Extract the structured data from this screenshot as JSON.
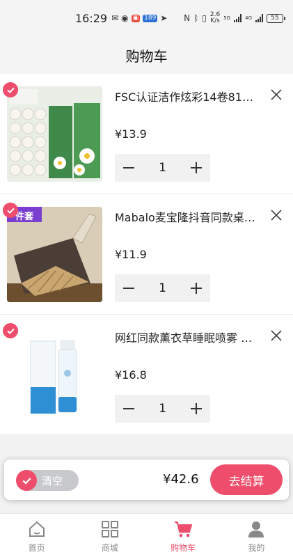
{
  "status_bar": {
    "time": "16:29",
    "badge_189": "189",
    "net_speed_value": "2.6",
    "net_speed_unit": "K/s",
    "sig1_label": "5G",
    "sig2_label": "4G",
    "battery": "55"
  },
  "header": {
    "title": "购物车"
  },
  "cart": {
    "items": [
      {
        "name": "FSC认证洁作炫彩14卷81…",
        "price": "¥13.9",
        "qty": "1",
        "checked": true,
        "thumb_tag": ""
      },
      {
        "name": "Mabalo麦宝隆抖音同款桌…",
        "price": "¥11.9",
        "qty": "1",
        "checked": true,
        "thumb_tag": "件套"
      },
      {
        "name": "网红同款薰衣草睡眠喷雾 …",
        "price": "¥16.8",
        "qty": "1",
        "checked": true,
        "thumb_tag": ""
      }
    ]
  },
  "checkout": {
    "clear_label": "清空",
    "total": "¥42.6",
    "button_label": "去结算"
  },
  "tabbar": {
    "tabs": [
      {
        "label": "首页",
        "icon": "home-icon",
        "active": false
      },
      {
        "label": "商城",
        "icon": "grid-icon",
        "active": false
      },
      {
        "label": "购物车",
        "icon": "cart-icon",
        "active": true
      },
      {
        "label": "我的",
        "icon": "user-icon",
        "active": false
      }
    ]
  },
  "colors": {
    "accent": "#ee4d6c",
    "background": "#f2f2f2",
    "toggle_track": "#c8c9cc"
  }
}
